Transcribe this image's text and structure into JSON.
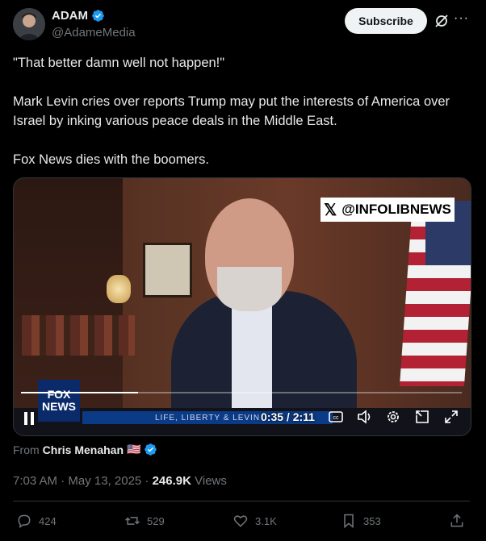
{
  "author": {
    "name": "ADAM",
    "handle": "@AdameMedia",
    "verified_color": "#1d9bf0"
  },
  "subscribe_label": "Subscribe",
  "icons": {
    "grok": "grok-icon",
    "more": "more-icon"
  },
  "post_text": "\"That better damn well not happen!\"\n\nMark Levin cries over reports Trump may put the interests of America over Israel by inking various peace deals in the Middle East.\n\nFox News dies with the boomers.",
  "video": {
    "watermark": "@INFOLIBNEWS",
    "fox_logo": "FOX\nNEWS",
    "lower_third": "LIFE, LIBERTY & LEVIN",
    "time": "0:35 / 2:11",
    "progress": 0.266
  },
  "source": {
    "prefix": "From",
    "name": "Chris Menahan",
    "flag": "🇺🇸"
  },
  "meta": {
    "timestamp": "7:03 AM · May 13, 2025 · ",
    "views_count": "246.9K",
    "views_label": " Views"
  },
  "actions": {
    "replies": "424",
    "reposts": "529",
    "likes": "3.1K",
    "bookmarks": "353"
  }
}
